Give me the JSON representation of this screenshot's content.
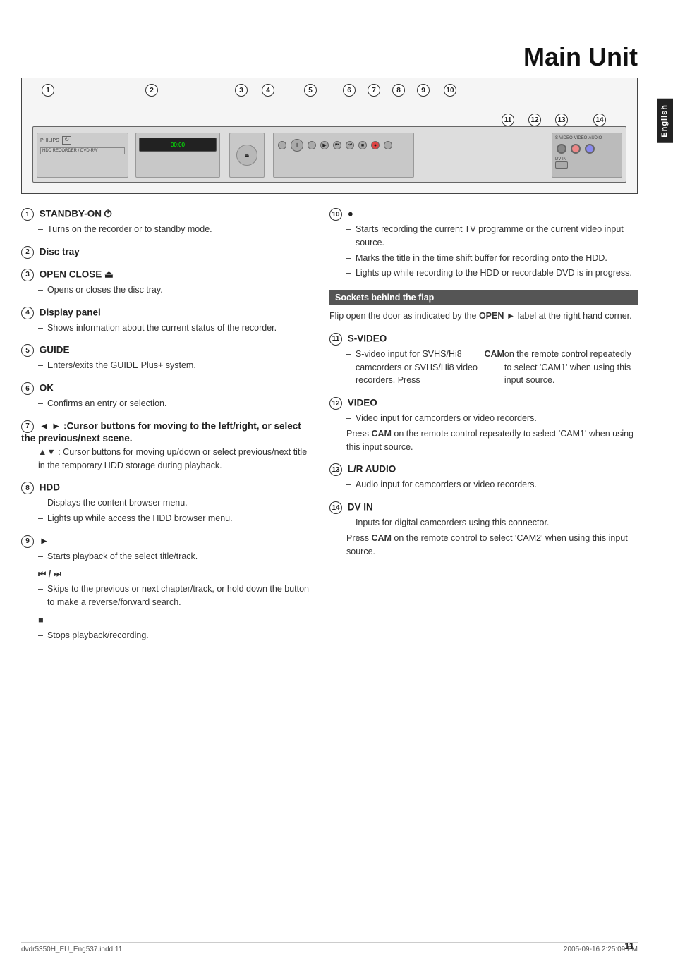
{
  "page": {
    "title": "Main Unit",
    "page_number": "11",
    "footer_left": "dvdr5350H_EU_Eng537.indd  11",
    "footer_right": "2005-09-16  2:25:09 PM",
    "language_tab": "English"
  },
  "diagram": {
    "callouts": [
      "1",
      "2",
      "3",
      "4",
      "5",
      "6",
      "7",
      "8",
      "9",
      "10",
      "11",
      "12",
      "13",
      "14"
    ]
  },
  "sections": {
    "left": [
      {
        "id": "s1",
        "num": "1",
        "title": "STANDBY-ON",
        "symbol": "power",
        "items": [
          "Turns on the recorder or to standby mode."
        ]
      },
      {
        "id": "s2",
        "num": "2",
        "title": "Disc tray",
        "items": []
      },
      {
        "id": "s3",
        "num": "3",
        "title": "OPEN CLOSE",
        "symbol": "eject",
        "items": [
          "Opens or closes the disc tray."
        ]
      },
      {
        "id": "s4",
        "num": "4",
        "title": "Display panel",
        "items": [
          "Shows information about the current status of the recorder."
        ]
      },
      {
        "id": "s5",
        "num": "5",
        "title": "GUIDE",
        "items": [
          "Enters/exits the GUIDE Plus+ system."
        ]
      },
      {
        "id": "s6",
        "num": "6",
        "title": "OK",
        "items": [
          "Confirms an entry or selection."
        ]
      },
      {
        "id": "s7",
        "num": "7",
        "title": "◄ ► :Cursor buttons for moving to the left/right, or select the previous/next scene.",
        "items": [
          "▲▼ : Cursor buttons for moving up/down or select previous/next title in the temporary HDD storage during playback."
        ]
      },
      {
        "id": "s8",
        "num": "8",
        "title": "HDD",
        "items": [
          "Displays the content browser menu.",
          "Lights up while access the HDD browser menu."
        ]
      },
      {
        "id": "s9",
        "num": "9",
        "title": "►",
        "items": [
          "Starts playback of the select title/track.",
          "",
          "⏮ / ⏭",
          "Skips to the previous or next chapter/track, or hold down the button to make a reverse/forward search.",
          "",
          "■",
          "Stops playback/recording."
        ]
      }
    ],
    "right": [
      {
        "id": "s10",
        "num": "10",
        "title": "●",
        "items": [
          "Starts recording the current TV programme or the current video input source.",
          "Marks the title in the time shift buffer for recording onto the HDD.",
          "Lights up while recording to the HDD or recordable DVD is in progress."
        ]
      },
      {
        "id": "sockets",
        "banner": "Sockets behind the flap",
        "text": "Flip open the door as indicated by the OPEN ► label at the right hand corner."
      },
      {
        "id": "s11",
        "num": "11",
        "title": "S-VIDEO",
        "items": [
          "S-video input for SVHS/Hi8 camcorders or SVHS/Hi8 video recorders. Press CAM on the remote control repeatedly to select 'CAM1' when using this input source."
        ]
      },
      {
        "id": "s12",
        "num": "12",
        "title": "VIDEO",
        "items": [
          "Video input for camcorders or video recorders.",
          "Press CAM on the remote control repeatedly to select 'CAM1' when using this input source."
        ]
      },
      {
        "id": "s13",
        "num": "13",
        "title": "L/R AUDIO",
        "items": [
          "Audio input for camcorders or video recorders."
        ]
      },
      {
        "id": "s14",
        "num": "14",
        "title": "DV IN",
        "items": [
          "Inputs for digital camcorders using this connector.",
          "Press CAM on the remote control to select 'CAM2' when using this input source."
        ]
      }
    ]
  }
}
